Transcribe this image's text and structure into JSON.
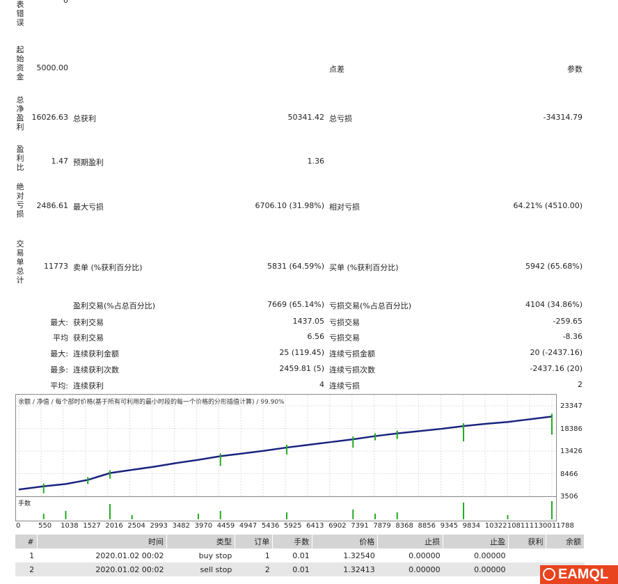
{
  "report": {
    "labels": {
      "errors": "表错误",
      "initial_deposit": "起始资金",
      "net_profit": "总净盈利",
      "profit_factor": "盈利比",
      "absolute_drawdown": "绝对亏损",
      "total_trades": "交易单总计"
    },
    "errors_value": "0",
    "initial_deposit": "5000.00",
    "spread_label": "点差",
    "params_label": "参数",
    "net_profit": "16026.63",
    "gross_profit_label": "总获利",
    "gross_profit": "50341.42",
    "gross_loss_label": "总亏损",
    "gross_loss": "-34314.79",
    "profit_factor": "1.47",
    "expected_payoff_label": "预期盈利",
    "expected_payoff": "1.36",
    "absolute_drawdown": "2486.61",
    "max_drawdown_label": "最大亏损",
    "max_drawdown": "6706.10 (31.98%)",
    "relative_drawdown_label": "相对亏损",
    "relative_drawdown": "64.21% (4510.00)",
    "total_trades": "11773",
    "short_label": "卖单 (%获利百分比)",
    "short_value": "5831 (64.59%)",
    "long_label": "买单 (%获利百分比)",
    "long_value": "5942 (65.68%)",
    "profit_trades_label": "盈利交易(%占总百分比)",
    "profit_trades": "7669 (65.14%)",
    "loss_trades_label": "亏损交易(%占总百分比)",
    "loss_trades": "4104 (34.86%)",
    "rows": [
      {
        "prefix": "最大:",
        "l1": "获利交易",
        "v1": "1437.05",
        "l2": "亏损交易",
        "v2": "-259.65"
      },
      {
        "prefix": "平均",
        "l1": "获利交易",
        "v1": "6.56",
        "l2": "亏损交易",
        "v2": "-8.36"
      },
      {
        "prefix": "最大:",
        "l1": "连续获利金额",
        "v1": "25 (119.45)",
        "l2": "连续亏损金额",
        "v2": "20 (-2437.16)"
      },
      {
        "prefix": "最多:",
        "l1": "连续获利次数",
        "v1": "2459.81 (5)",
        "l2": "连续亏损次数",
        "v2": "-2437.16 (20)"
      },
      {
        "prefix": "平均:",
        "l1": "连续获利",
        "v1": "4",
        "l2": "连续亏损",
        "v2": "2"
      }
    ]
  },
  "chart": {
    "header": "余额 / 净值 / 每个部时价格(基于所有可利用的最小时段的每一个价格的分形插值计算) / 99.90%",
    "volume_label": "手数",
    "colors": {
      "balance": "#1a237e",
      "volume": "#22aa22"
    },
    "y_labels": [
      "23347",
      "18386",
      "13426",
      "8466",
      "3506"
    ],
    "x_labels": [
      "0",
      "550",
      "1038",
      "1527",
      "2016",
      "2504",
      "2993",
      "3482",
      "3970",
      "4459",
      "4947",
      "5436",
      "5925",
      "6413",
      "6902",
      "7391",
      "7879",
      "8368",
      "8856",
      "9345",
      "9834",
      "10322",
      "10811",
      "11300",
      "11788"
    ]
  },
  "chart_data": {
    "type": "line",
    "title": "余额 / 净值 / 每个部时价格(基于所有可利用的最小时段的每一个价格的分形插值计算) / 99.90%",
    "xlabel": "",
    "ylabel": "",
    "ylim": [
      3506,
      23347
    ],
    "x": [
      0,
      550,
      1038,
      1527,
      2016,
      2504,
      2993,
      3482,
      3970,
      4459,
      4947,
      5436,
      5925,
      6413,
      6902,
      7391,
      7879,
      8368,
      8856,
      9345,
      9834,
      10322,
      10811,
      11300,
      11788
    ],
    "series": [
      {
        "name": "余额",
        "values": [
          5000,
          5700,
          6200,
          7100,
          8600,
          9300,
          10000,
          10800,
          11500,
          12300,
          12900,
          13500,
          14200,
          14800,
          15400,
          16000,
          16700,
          17300,
          17800,
          18300,
          18900,
          19400,
          19800,
          20400,
          21000
        ]
      }
    ],
    "grid": true
  },
  "trades": {
    "headers": [
      "#",
      "时间",
      "类型",
      "订单",
      "手数",
      "价格",
      "止损",
      "止盈",
      "获利",
      "余额"
    ],
    "rows": [
      [
        "1",
        "2020.01.02 00:02",
        "buy stop",
        "1",
        "0.01",
        "1.32540",
        "0.00000",
        "0.00000",
        "",
        ""
      ],
      [
        "2",
        "2020.01.02 00:02",
        "sell stop",
        "2",
        "0.01",
        "1.32413",
        "0.00000",
        "0.00000",
        "",
        ""
      ]
    ]
  },
  "watermark": {
    "text": "EAMQL"
  }
}
